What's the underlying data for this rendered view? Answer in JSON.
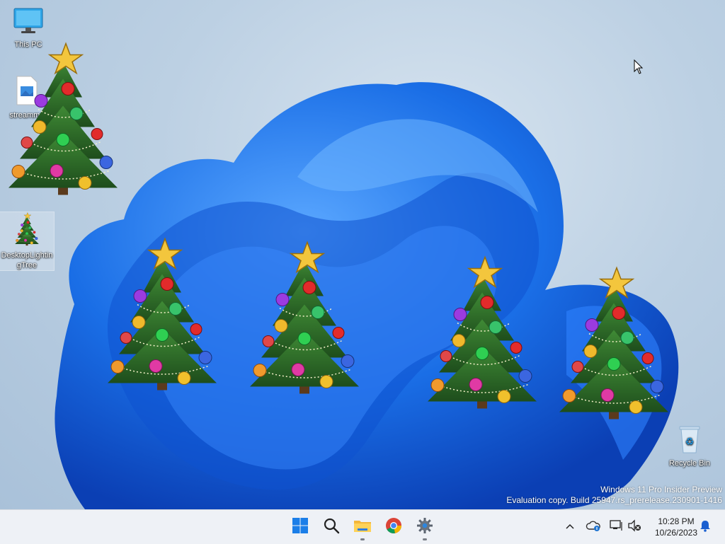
{
  "desktop": {
    "icons": [
      {
        "label": "This PC",
        "icon": "monitor-icon"
      },
      {
        "label": "streamma",
        "icon": "image-file-icon"
      },
      {
        "label": "DesktopLightingTree",
        "icon": "tree-app-icon"
      },
      {
        "label": "Recycle Bin",
        "icon": "recycle-bin-icon"
      }
    ],
    "watermark": {
      "line1": "Windows 11 Pro Insider Preview",
      "line2": "Evaluation copy. Build 25947.rs_prerelease.230901-1416"
    }
  },
  "taskbar": {
    "apps": [
      {
        "name": "Start",
        "icon": "windows-start-icon"
      },
      {
        "name": "Search",
        "icon": "search-icon"
      },
      {
        "name": "File Explorer",
        "icon": "folder-icon"
      },
      {
        "name": "Google Chrome",
        "icon": "chrome-icon"
      },
      {
        "name": "Settings",
        "icon": "gear-icon"
      }
    ],
    "tray": {
      "icons": [
        "chevron-up-icon",
        "onedrive-icon",
        "network-icon",
        "volume-muted-icon",
        "notification-bell-icon"
      ],
      "time": "10:28 PM",
      "date": "10/26/2023"
    }
  },
  "colors": {
    "wallpaper_bloom": "#1a6ee6",
    "taskbar": "#eef1f6",
    "tree_green": "#2f6b2a",
    "star_gold": "#f3c63d"
  }
}
